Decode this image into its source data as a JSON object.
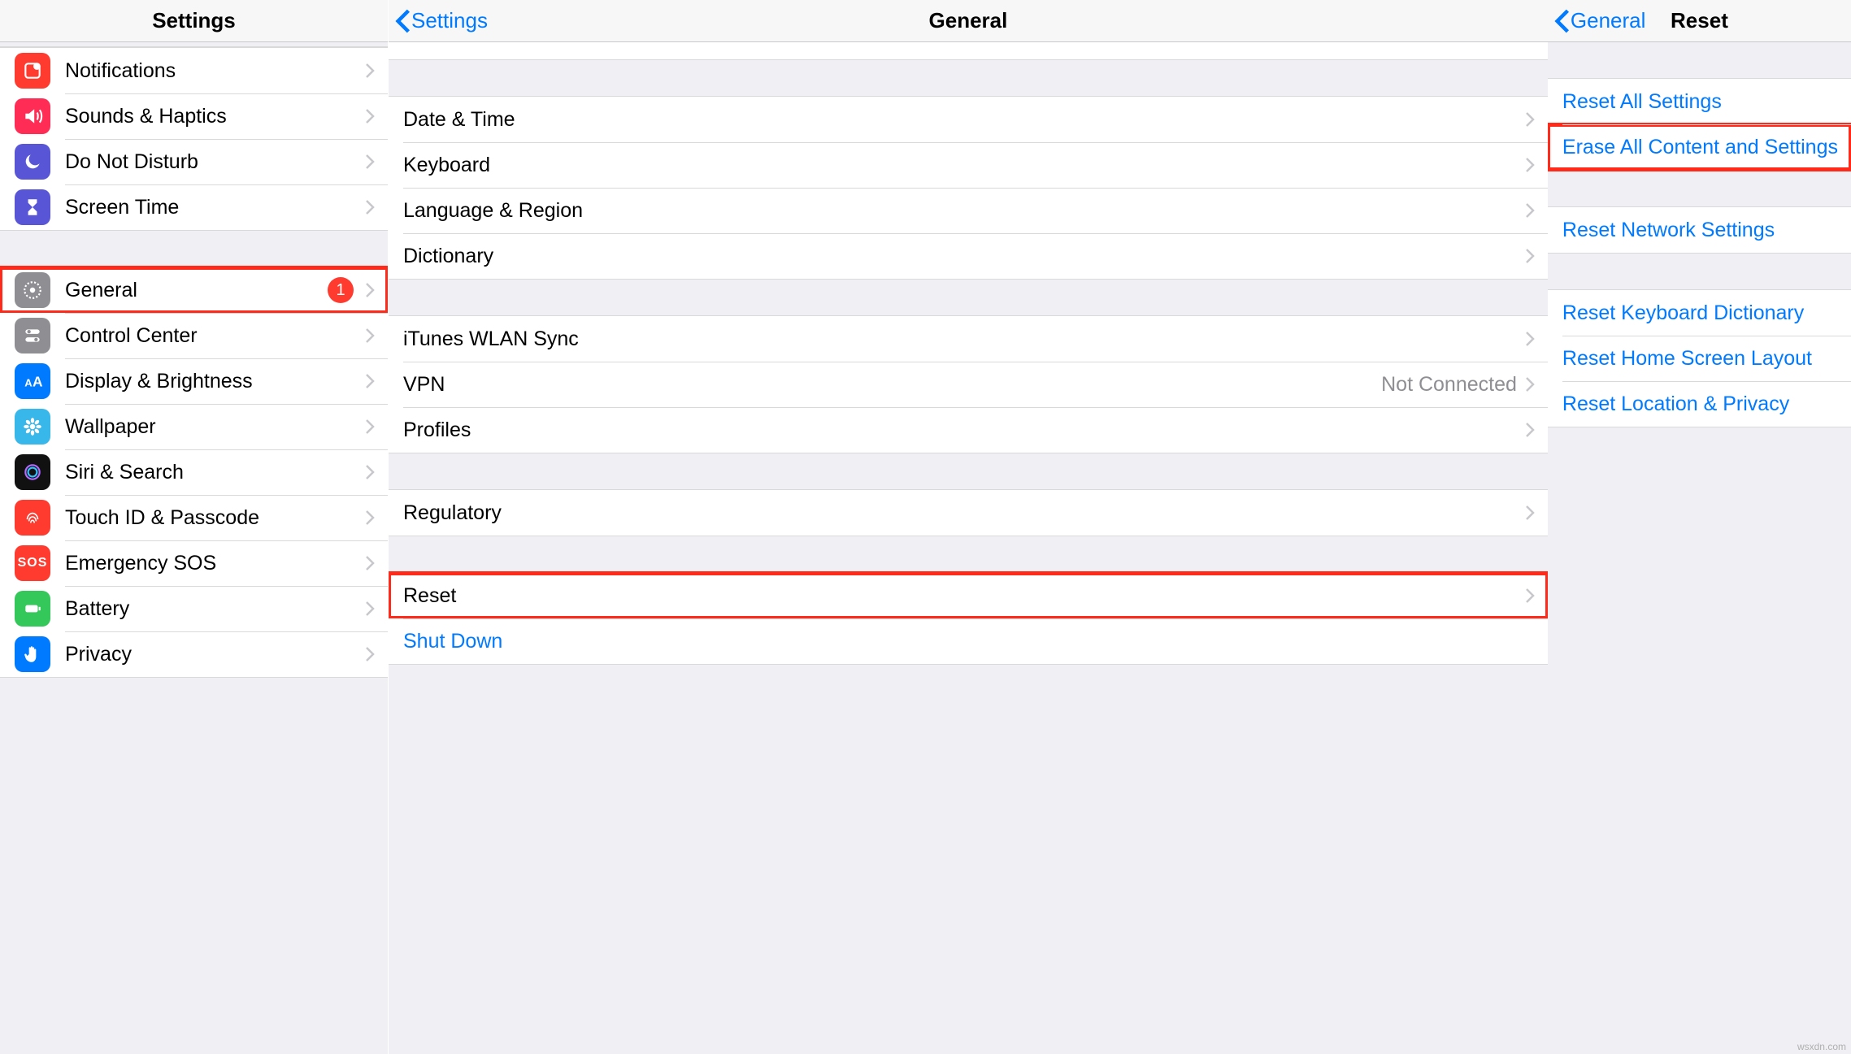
{
  "panel1": {
    "title": "Settings",
    "items_a": [
      {
        "label": "Notifications"
      },
      {
        "label": "Sounds & Haptics"
      },
      {
        "label": "Do Not Disturb"
      },
      {
        "label": "Screen Time"
      }
    ],
    "items_b": [
      {
        "label": "General",
        "badge": "1",
        "highlight": true
      },
      {
        "label": "Control Center"
      },
      {
        "label": "Display & Brightness"
      },
      {
        "label": "Wallpaper"
      },
      {
        "label": "Siri & Search"
      },
      {
        "label": "Touch ID & Passcode"
      },
      {
        "label": "Emergency SOS"
      },
      {
        "label": "Battery"
      },
      {
        "label": "Privacy"
      }
    ]
  },
  "panel2": {
    "back": "Settings",
    "title": "General",
    "group1": [
      {
        "label": "Date & Time"
      },
      {
        "label": "Keyboard"
      },
      {
        "label": "Language & Region"
      },
      {
        "label": "Dictionary"
      }
    ],
    "group2": [
      {
        "label": "iTunes WLAN Sync"
      },
      {
        "label": "VPN",
        "detail": "Not Connected"
      },
      {
        "label": "Profiles"
      }
    ],
    "group3": [
      {
        "label": "Regulatory"
      }
    ],
    "group4": [
      {
        "label": "Reset",
        "highlight": true
      },
      {
        "label": "Shut Down",
        "blue": true,
        "nochev": true
      }
    ]
  },
  "panel3": {
    "back": "General",
    "title": "Reset",
    "group1": [
      {
        "label": "Reset All Settings"
      },
      {
        "label": "Erase All Content and Settings",
        "highlight": true
      }
    ],
    "group2": [
      {
        "label": "Reset Network Settings"
      }
    ],
    "group3": [
      {
        "label": "Reset Keyboard Dictionary"
      },
      {
        "label": "Reset Home Screen Layout"
      },
      {
        "label": "Reset Location & Privacy"
      }
    ]
  },
  "attribution": "wsxdn.com"
}
